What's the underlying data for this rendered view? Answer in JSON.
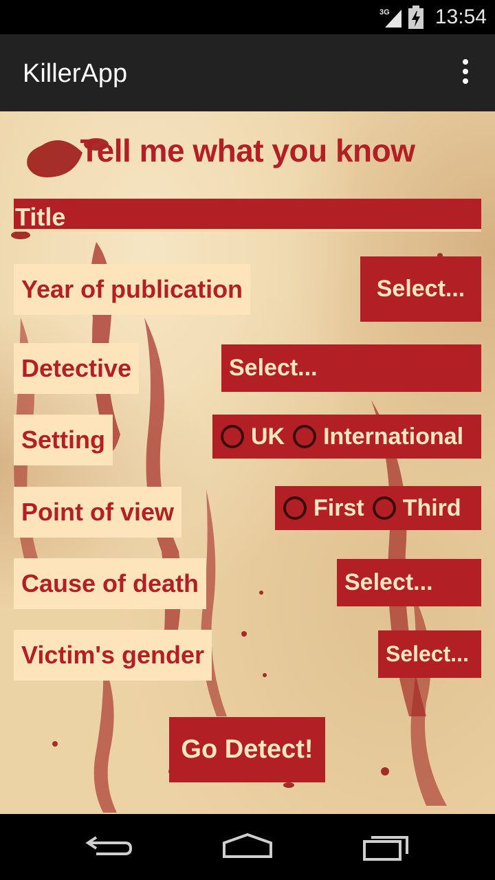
{
  "status_bar": {
    "network": "3G",
    "time": "13:54"
  },
  "action_bar": {
    "title": "KillerApp",
    "overflow_icon": "overflow-menu-icon"
  },
  "heading": "Tell me what you know",
  "title_field": {
    "label": "Title"
  },
  "rows": {
    "year": {
      "label": "Year of publication",
      "button": "Select..."
    },
    "detective": {
      "label": "Detective",
      "button": "Select..."
    },
    "setting": {
      "label": "Setting",
      "options": [
        "UK",
        "International"
      ]
    },
    "pov": {
      "label": "Point of view",
      "options": [
        "First",
        "Third"
      ]
    },
    "cause": {
      "label": "Cause of death",
      "button": "Select..."
    },
    "gender": {
      "label": "Victim's gender",
      "button": "Select..."
    }
  },
  "go_button": "Go Detect!",
  "nav": {
    "back": "back-icon",
    "home": "home-icon",
    "recents": "recents-icon"
  },
  "colors": {
    "accent": "#b22025",
    "label_bg": "#fde4bb",
    "parchment": "#ecd3a6"
  }
}
